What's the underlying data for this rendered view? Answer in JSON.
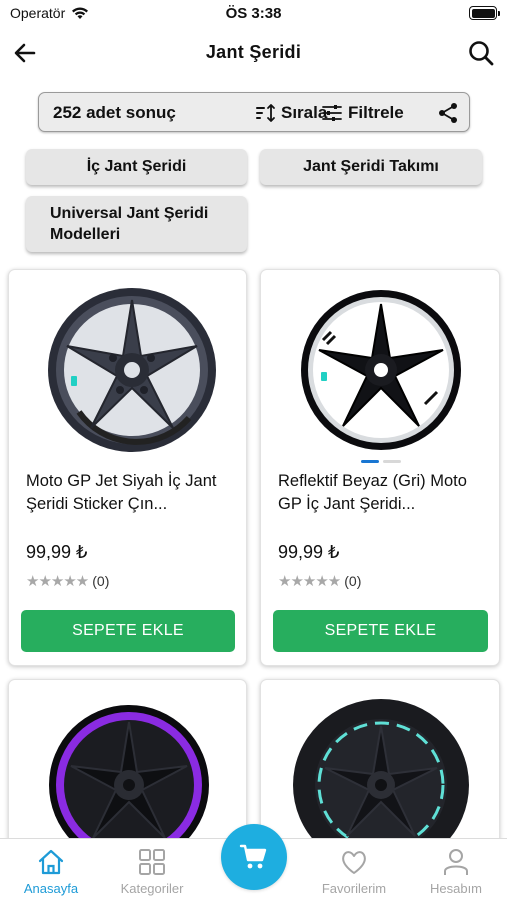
{
  "status_bar": {
    "carrier": "Operatör",
    "time": "ÖS 3:38"
  },
  "header": {
    "title": "Jant Şeridi"
  },
  "toolbar": {
    "result_count": "252 adet sonuç",
    "sort_label": "Sırala",
    "filter_label": "Filtrele"
  },
  "categories": [
    "İç Jant Şeridi",
    "Jant Şeridi Takımı",
    "Universal Jant Şeridi Modelleri"
  ],
  "products": [
    {
      "title": "Moto GP Jet Siyah İç Jant Şeridi Sticker Çın...",
      "price": "99,99 ₺",
      "rating_count": "(0)",
      "rating": 0,
      "add_label": "SEPETE EKLE"
    },
    {
      "title": "Reflektif Beyaz (Gri) Moto GP İç Jant Şeridi...",
      "price": "99,99 ₺",
      "rating_count": "(0)",
      "rating": 0,
      "add_label": "SEPETE EKLE"
    }
  ],
  "bottom_nav": {
    "home": "Anasayfa",
    "categories": "Kategoriler",
    "favorites": "Favorilerim",
    "account": "Hesabım"
  },
  "colors": {
    "primary": "#1e9bd7",
    "add_button": "#27ae5e",
    "fab": "#1eaee0",
    "inactive": "#a5a5a5"
  }
}
